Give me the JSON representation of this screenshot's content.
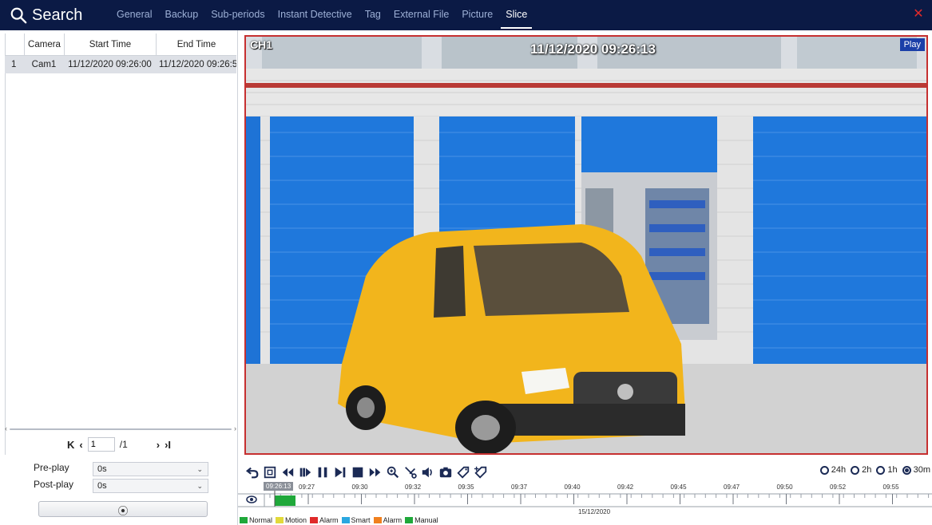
{
  "header": {
    "title": "Search",
    "tabs": [
      {
        "label": "General",
        "active": false
      },
      {
        "label": "Backup",
        "active": false
      },
      {
        "label": "Sub-periods",
        "active": false
      },
      {
        "label": "Instant Detective",
        "active": false
      },
      {
        "label": "Tag",
        "active": false
      },
      {
        "label": "External File",
        "active": false
      },
      {
        "label": "Picture",
        "active": false
      },
      {
        "label": "Slice",
        "active": true
      }
    ],
    "close_icon": "close-icon",
    "accent": "#0b1a45"
  },
  "slice_table": {
    "columns": [
      "",
      "Camera",
      "Start Time",
      "End Time"
    ],
    "rows": [
      {
        "index": "1",
        "camera": "Cam1",
        "start": "11/12/2020 09:26:00",
        "end": "11/12/2020 09:26:5"
      }
    ]
  },
  "pager": {
    "page": "1",
    "total": "/1"
  },
  "options": {
    "preplay_label": "Pre-play",
    "preplay_value": "0s",
    "postplay_label": "Post-play",
    "postplay_value": "0s"
  },
  "video": {
    "channel": "CH1",
    "osd_time": "11/12/2020 09:26:13",
    "status": "Play"
  },
  "timeline": {
    "zoom_options": [
      {
        "label": "24h",
        "selected": false
      },
      {
        "label": "2h",
        "selected": false
      },
      {
        "label": "1h",
        "selected": false
      },
      {
        "label": "30m",
        "selected": true
      }
    ],
    "cursor_time": "09:26:13",
    "tick_labels": [
      "09:27",
      "09:30",
      "09:32",
      "09:35",
      "09:37",
      "09:40",
      "09:42",
      "09:45",
      "09:47",
      "09:50",
      "09:52",
      "09:55"
    ],
    "date": "15/12/2020",
    "recorded_segment": {
      "start": "09:26:00",
      "end": "09:26:55",
      "type": "Manual"
    }
  },
  "legend": [
    {
      "label": "Normal",
      "color": "#1fa83a"
    },
    {
      "label": "Motion",
      "color": "#e2d93a"
    },
    {
      "label": "Alarm",
      "color": "#e02a2a"
    },
    {
      "label": "Smart",
      "color": "#2aa7e0"
    },
    {
      "label": "Alarm",
      "color": "#f0801e"
    },
    {
      "label": "Manual",
      "color": "#1fa83a"
    }
  ]
}
